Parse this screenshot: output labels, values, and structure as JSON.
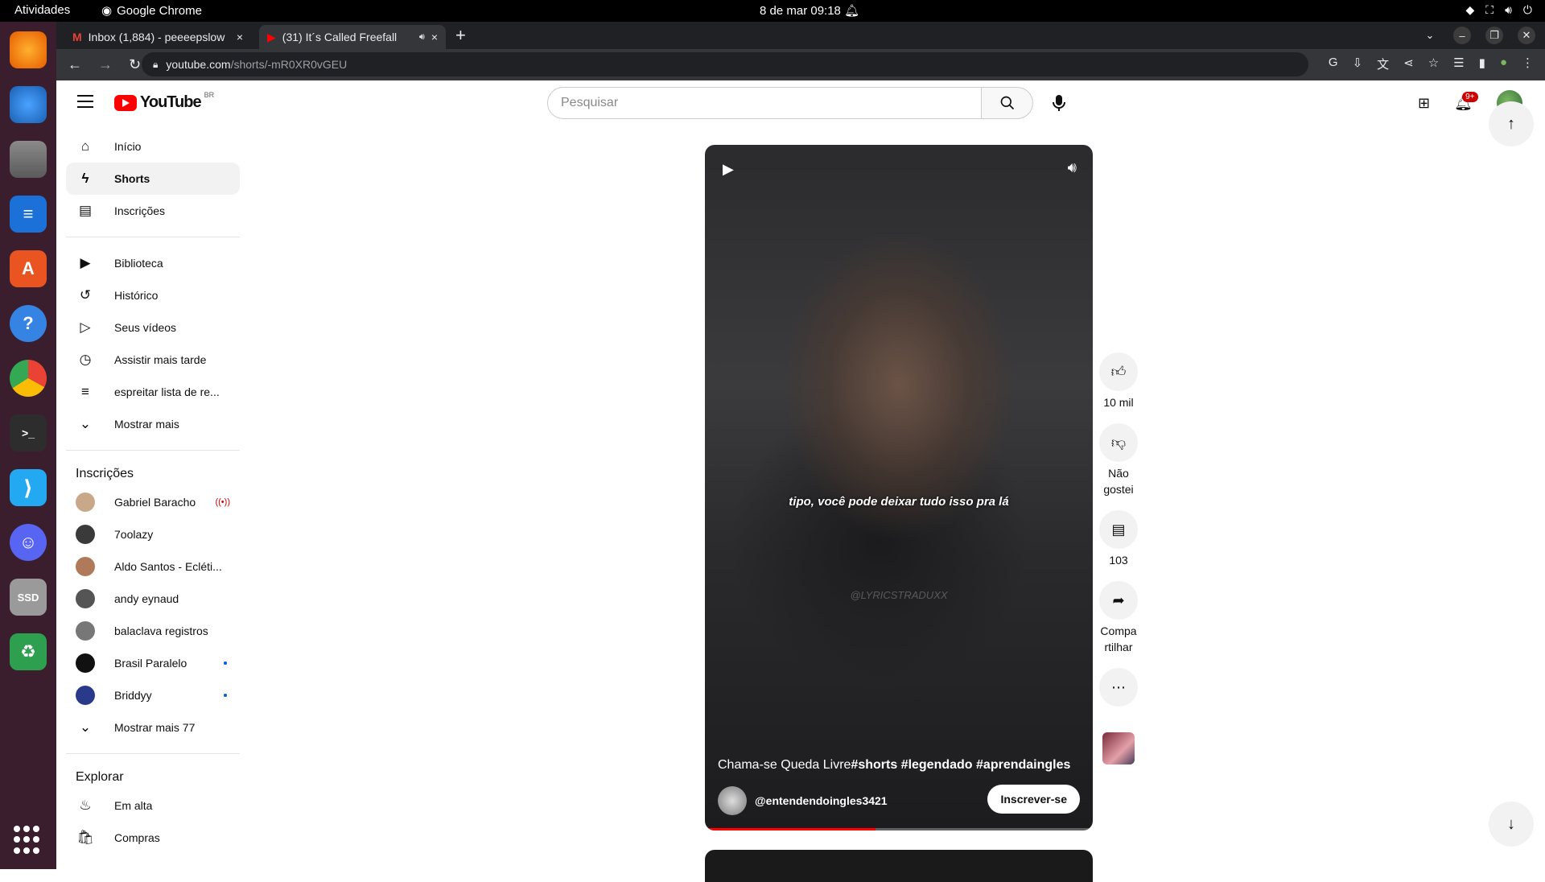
{
  "os": {
    "activities": "Atividades",
    "app_name": "Google Chrome",
    "clock": "8 de mar  09:18"
  },
  "tabs": [
    {
      "title": "Inbox (1,884) - peeeepslow",
      "close": "×"
    },
    {
      "title": "(31) It´s Called Freefall",
      "close": "×"
    }
  ],
  "address": {
    "host": "youtube.com",
    "path": "/shorts/-mR0XR0vGEU"
  },
  "youtube": {
    "logo": "YouTube",
    "country": "BR",
    "search_placeholder": "Pesquisar",
    "notif_badge": "9+"
  },
  "sidebar": {
    "main": [
      {
        "label": "Início",
        "icon": "home-icon"
      },
      {
        "label": "Shorts",
        "icon": "shorts-icon"
      },
      {
        "label": "Inscrições",
        "icon": "subscriptions-icon"
      }
    ],
    "library": [
      {
        "label": "Biblioteca",
        "icon": "library-icon"
      },
      {
        "label": "Histórico",
        "icon": "history-icon"
      },
      {
        "label": "Seus vídeos",
        "icon": "your-videos-icon"
      },
      {
        "label": "Assistir mais tarde",
        "icon": "watch-later-icon"
      },
      {
        "label": "espreitar lista de re...",
        "icon": "playlist-icon"
      },
      {
        "label": "Mostrar mais",
        "icon": "chevron-down-icon"
      }
    ],
    "subs_heading": "Inscrições",
    "subscriptions": [
      {
        "label": "Gabriel Baracho",
        "indicator": "live",
        "color": "#c9a88a"
      },
      {
        "label": "7oolazy",
        "indicator": "",
        "color": "#3a3a3a"
      },
      {
        "label": "Aldo Santos - Ecléti...",
        "indicator": "",
        "color": "#b07a5a"
      },
      {
        "label": "andy eynaud",
        "indicator": "",
        "color": "#555"
      },
      {
        "label": "balaclava registros",
        "indicator": "",
        "color": "#777"
      },
      {
        "label": "Brasil Paralelo",
        "indicator": "new",
        "color": "#111"
      },
      {
        "label": "Briddyy",
        "indicator": "new",
        "color": "#2a3a8a"
      }
    ],
    "show_more_subs": "Mostrar mais 77",
    "explore_heading": "Explorar",
    "explore": [
      {
        "label": "Em alta",
        "icon": "trending-icon"
      },
      {
        "label": "Compras",
        "icon": "shopping-icon"
      }
    ]
  },
  "short": {
    "caption": "tipo, você pode deixar tudo isso pra lá",
    "watermark": "@LYRICSTRADUXX",
    "title_plain": "Chama-se Queda Livre",
    "title_tags": "#shorts #legendado #aprendaingles",
    "channel": "@entendendoingles3421",
    "subscribe": "Inscrever-se",
    "progress_fraction": 0.44
  },
  "actions": {
    "likes": "10 mil",
    "dislike": "Não\ngostei",
    "comments": "103",
    "share": "Compa\nrtilhar"
  }
}
